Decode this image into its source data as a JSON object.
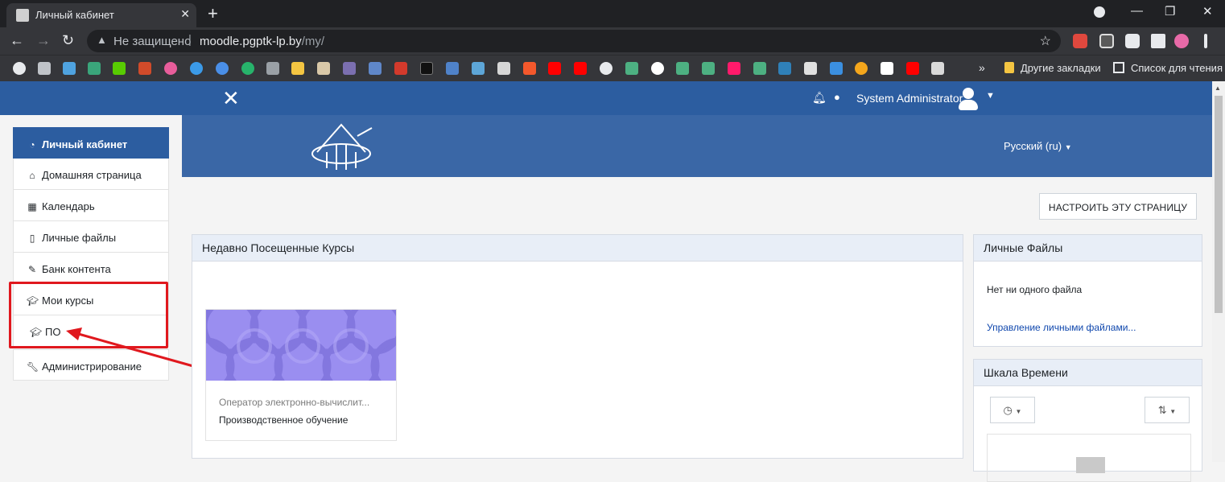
{
  "browser": {
    "tab_title": "Личный кабинет",
    "new_tab_glyph": "+",
    "url_warning": "Не защищено",
    "url_host": "moodle.pgptk-lp.by",
    "url_path": "/my/",
    "bookmarks_more": "»",
    "bookmark_folder_other": "Другие закладки",
    "reading_list": "Список для чтения"
  },
  "header": {
    "username": "System Administrator",
    "language": "Русский (ru)"
  },
  "sidebar": {
    "items": [
      {
        "label": "Личный кабинет",
        "icon": "dashboard-icon"
      },
      {
        "label": "Домашняя страница",
        "icon": "home-icon"
      },
      {
        "label": "Календарь",
        "icon": "calendar-icon"
      },
      {
        "label": "Личные файлы",
        "icon": "file-icon"
      },
      {
        "label": "Банк контента",
        "icon": "brush-icon"
      },
      {
        "label": "Мои курсы",
        "icon": "graduation-cap-icon"
      },
      {
        "label": "ПО",
        "icon": "graduation-cap-icon"
      },
      {
        "label": "Администрирование",
        "icon": "wrench-icon"
      }
    ]
  },
  "main": {
    "customize_button": "НАСТРОИТЬ ЭТУ СТРАНИЦУ",
    "recent_courses": {
      "title": "Недавно Посещенные Курсы",
      "course_name": "Оператор электронно-вычислит...",
      "course_category": "Производственное обучение"
    },
    "private_files": {
      "title": "Личные Файлы",
      "empty_text": "Нет ни одного файла",
      "manage_link": "Управление личными файлами..."
    },
    "timeline": {
      "title": "Шкала Времени"
    }
  },
  "colors": {
    "moodle_blue": "#2c5da0",
    "annotation_red": "#e0181e"
  }
}
